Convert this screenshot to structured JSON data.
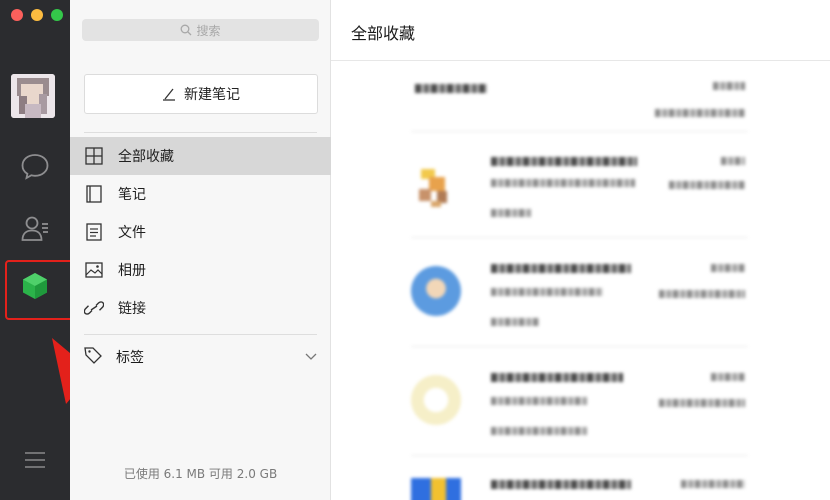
{
  "window": {
    "traffic_lights": [
      "close",
      "minimize",
      "zoom"
    ]
  },
  "rail": {
    "icons": [
      "chat-icon",
      "contacts-icon",
      "favorites-icon",
      "menu-icon"
    ],
    "active": "favorites-icon",
    "highlight_color": "#e3211b"
  },
  "sidebar": {
    "search_placeholder": "搜索",
    "new_note_label": "新建笔记",
    "items": [
      {
        "label": "全部收藏",
        "icon": "grid-icon",
        "active": true
      },
      {
        "label": "笔记",
        "icon": "notebook-icon",
        "active": false
      },
      {
        "label": "文件",
        "icon": "file-icon",
        "active": false
      },
      {
        "label": "相册",
        "icon": "image-icon",
        "active": false
      },
      {
        "label": "链接",
        "icon": "link-icon",
        "active": false
      }
    ],
    "tags_label": "标签",
    "storage_usage": "已使用 6.1 MB 可用 2.0 GB"
  },
  "main": {
    "title": "全部收藏"
  },
  "colors": {
    "rail_bg": "#2b2c2f",
    "sidebar_bg": "#f7f7f7",
    "active_item_bg": "#d7d7d7",
    "favorites_green": "#2bb34a",
    "annotation_red": "#e3211b"
  }
}
